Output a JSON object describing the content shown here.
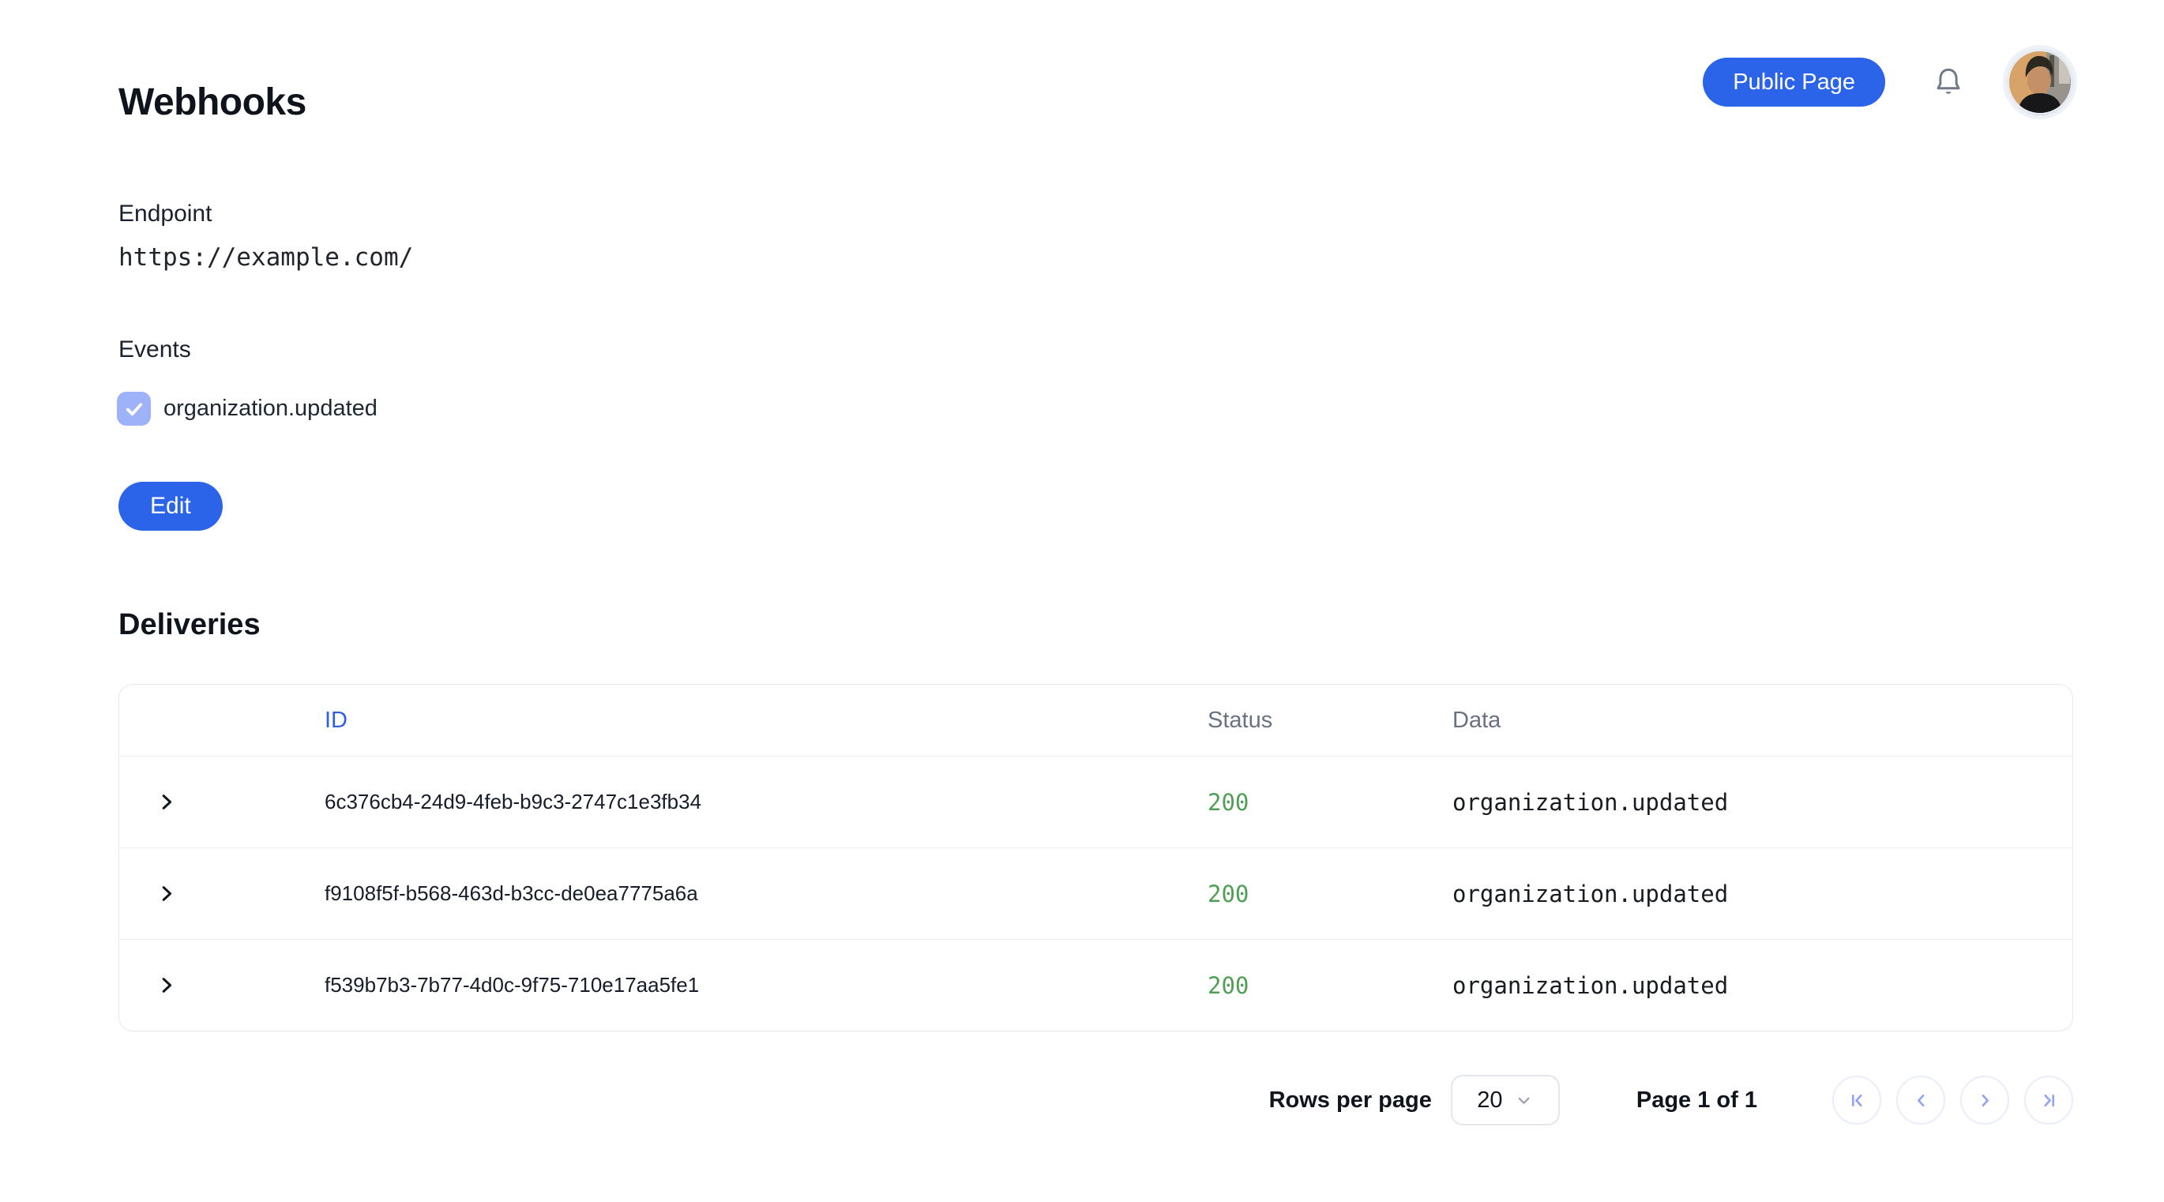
{
  "page": {
    "title": "Webhooks"
  },
  "topbar": {
    "public_page_button": "Public Page",
    "bell_icon": "bell",
    "avatar": "user-avatar"
  },
  "endpoint": {
    "label": "Endpoint",
    "url": "https://example.com/"
  },
  "events": {
    "label": "Events",
    "items": [
      {
        "label": "organization.updated",
        "checked": true
      }
    ]
  },
  "actions": {
    "edit_button": "Edit"
  },
  "deliveries": {
    "title": "Deliveries",
    "table": {
      "columns": {
        "id": "ID",
        "status": "Status",
        "data": "Data"
      },
      "rows": [
        {
          "id": "6c376cb4-24d9-4feb-b9c3-2747c1e3fb34",
          "status": "200",
          "data": "organization.updated"
        },
        {
          "id": "f9108f5f-b568-463d-b3cc-de0ea7775a6a",
          "status": "200",
          "data": "organization.updated"
        },
        {
          "id": "f539b7b3-7b77-4d0c-9f75-710e17aa5fe1",
          "status": "200",
          "data": "organization.updated"
        }
      ]
    },
    "pagination": {
      "rows_per_page_label": "Rows per page",
      "rows_per_page_value": "20",
      "page_label": "Page 1 of 1",
      "buttons": [
        "first-page",
        "previous-page",
        "next-page",
        "last-page"
      ]
    }
  },
  "colors": {
    "accent_blue": "#2b63e9",
    "link_blue": "#2e5ee7",
    "status_green": "#4f9f55",
    "checkbox_blue": "#9db2f8",
    "pagination_icon_blue": "#8fa5f1"
  }
}
